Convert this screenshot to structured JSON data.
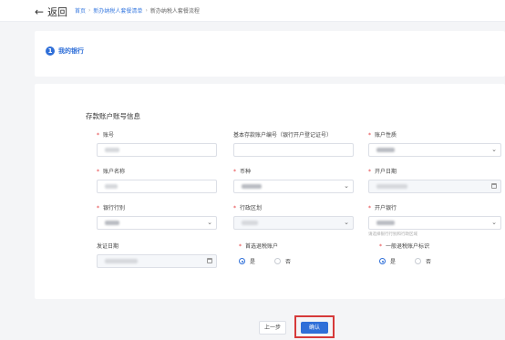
{
  "topbar": {
    "back_label": "返回",
    "breadcrumb": [
      "首页",
      "新办纳税人套餐清单",
      "新办纳税人套餐流程"
    ]
  },
  "step": {
    "number": "1",
    "title": "我的银行"
  },
  "section": {
    "title": "存款账户账号信息"
  },
  "fields": {
    "account_no": {
      "label": "账号",
      "required": true
    },
    "basic_account_no": {
      "label": "基本存款账户编号（银行开户登记证号）",
      "required": false
    },
    "account_type": {
      "label": "账户性质",
      "required": true
    },
    "account_name": {
      "label": "账户名称",
      "required": true
    },
    "currency": {
      "label": "币种",
      "required": true
    },
    "open_date": {
      "label": "开户日期",
      "required": true
    },
    "bank_category": {
      "label": "银行行别",
      "required": true
    },
    "admin_region": {
      "label": "行政区划",
      "required": true
    },
    "open_bank": {
      "label": "开户银行",
      "required": true,
      "hint": "请选择银行行别和行政区域"
    },
    "issue_date": {
      "label": "发证日期",
      "required": false
    },
    "preferred_refund": {
      "label": "首选退税账户",
      "required": true,
      "options": [
        "是",
        "否"
      ],
      "selected": "是"
    },
    "general_refund": {
      "label": "一般退税账户标识",
      "required": true,
      "options": [
        "是",
        "否"
      ],
      "selected": "是"
    }
  },
  "footer": {
    "prev_label": "上一步",
    "confirm_label": "确认"
  }
}
